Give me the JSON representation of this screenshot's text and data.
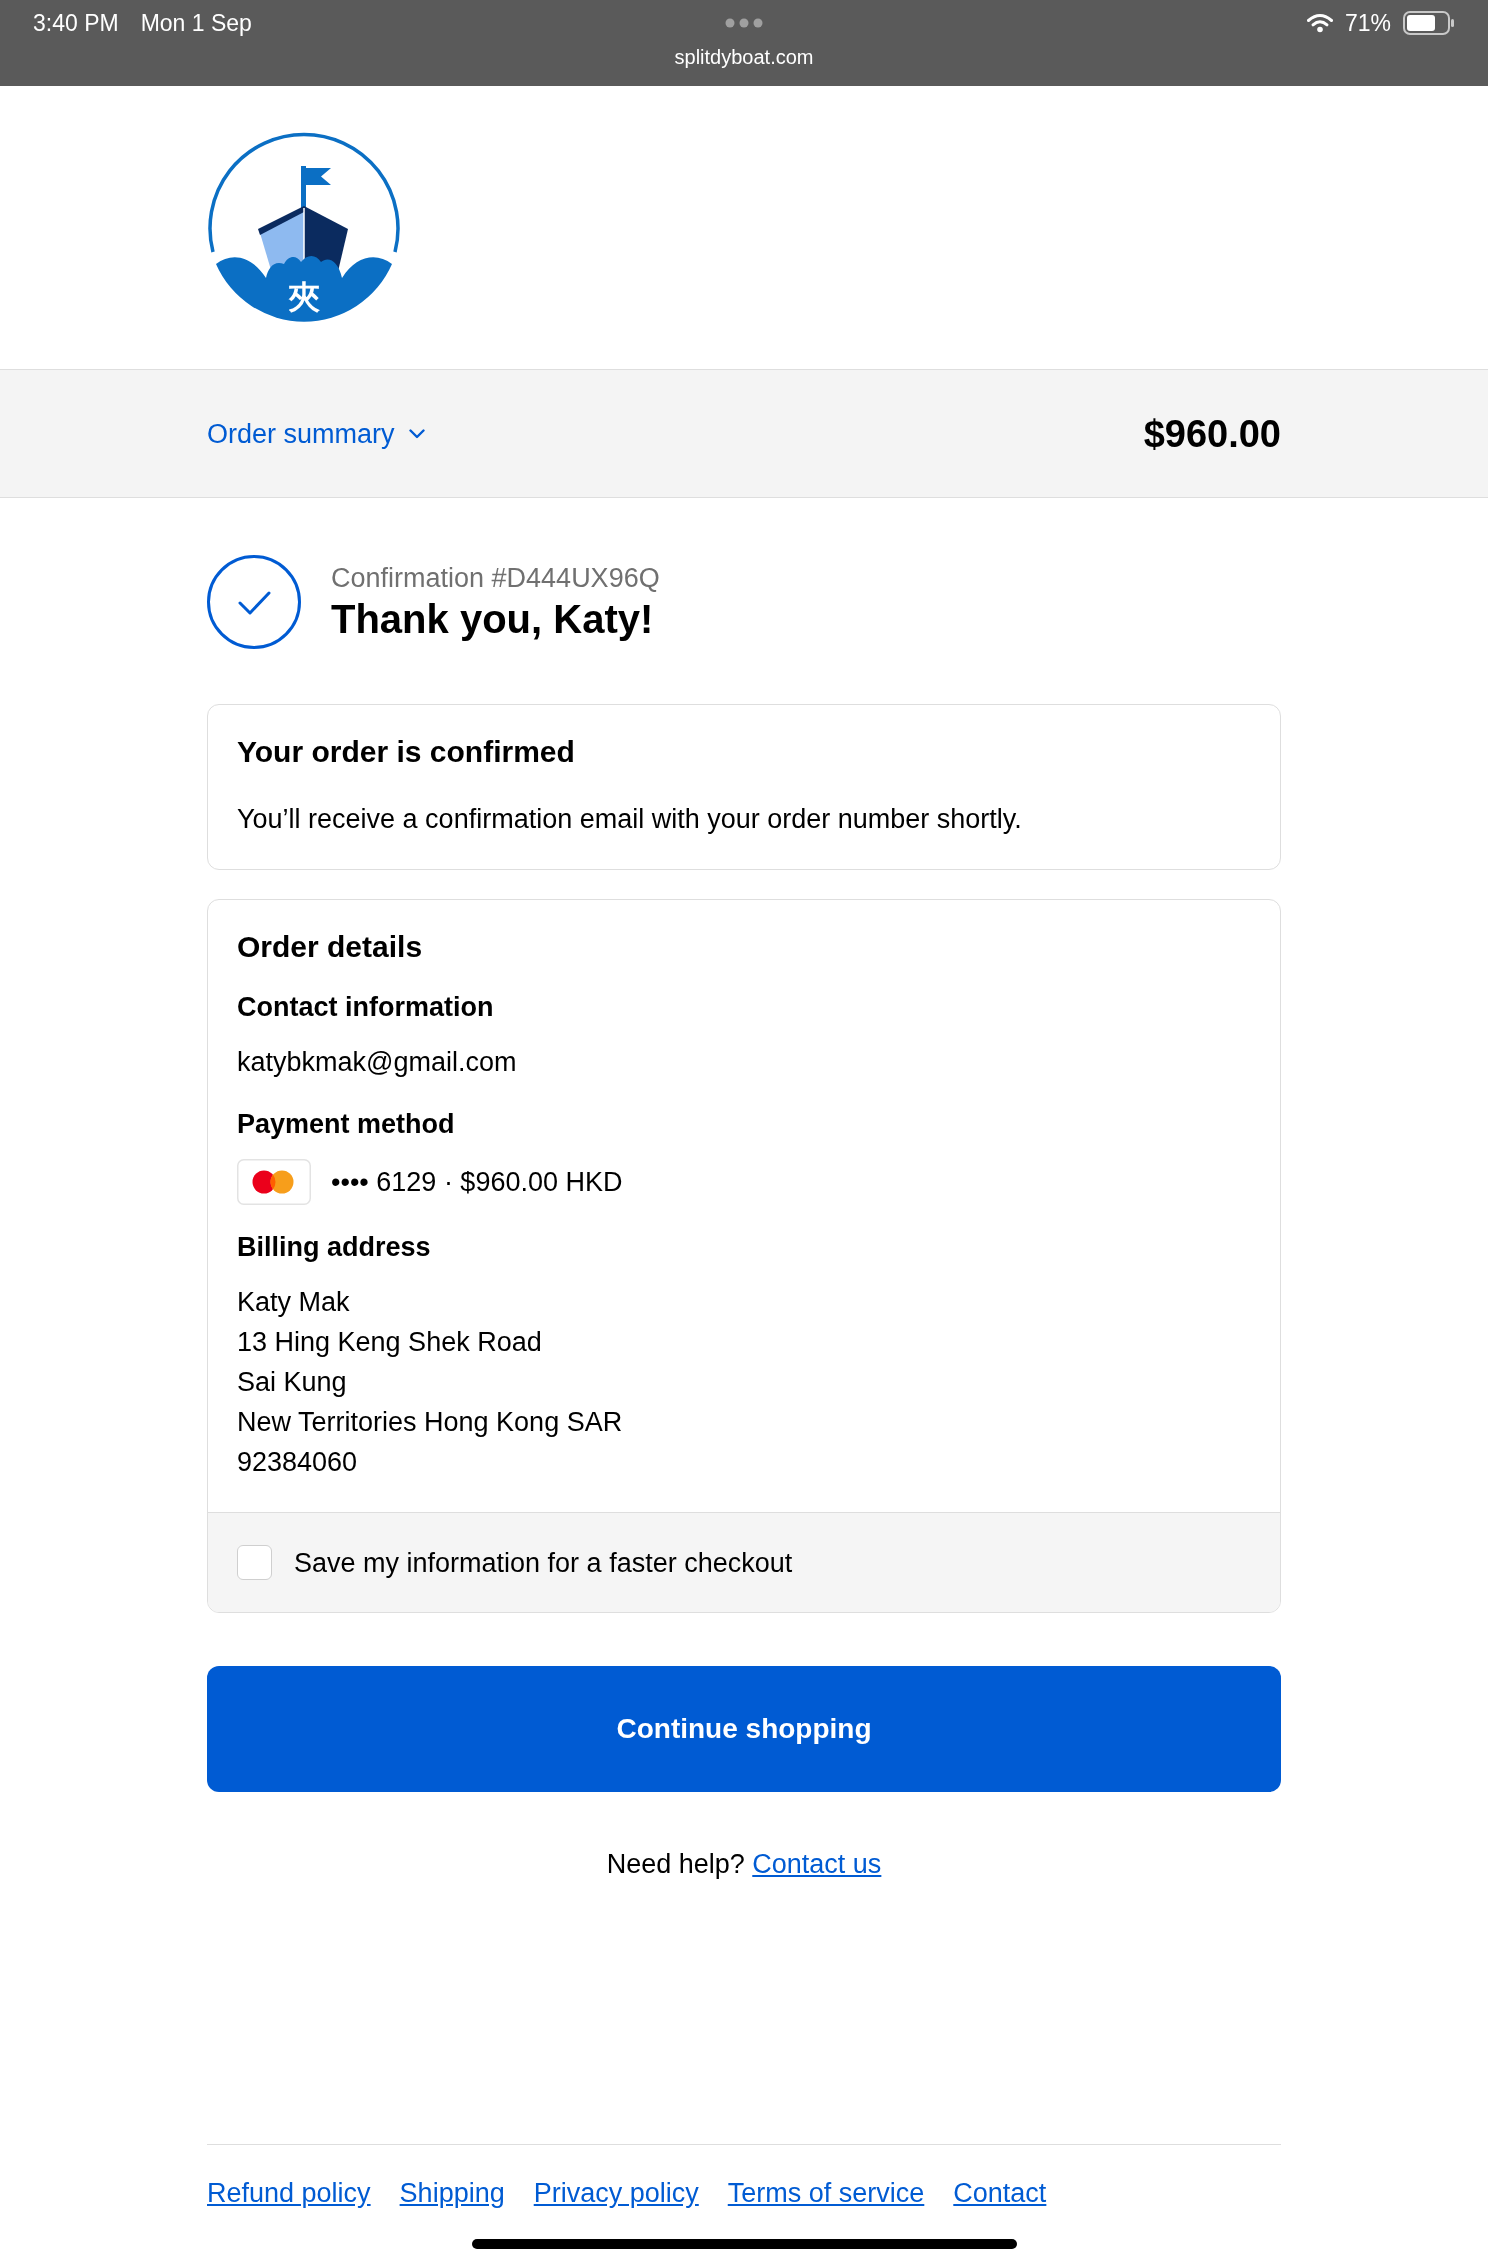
{
  "status_bar": {
    "time": "3:40 PM",
    "date": "Mon 1 Sep",
    "url": "splitdyboat.com",
    "battery": "71%"
  },
  "header": {
    "logo_text": "夾"
  },
  "order_summary": {
    "label": "Order summary",
    "expanded": false,
    "total": "$960.00"
  },
  "confirmation": {
    "number": "Confirmation #D444UX96Q",
    "title": "Thank you, Katy!"
  },
  "confirmed_card": {
    "title": "Your order is confirmed",
    "message": "You’ll receive a confirmation email with your order number shortly."
  },
  "order_details": {
    "title": "Order details",
    "sections": [
      {
        "kind": "text",
        "heading": "Contact information",
        "lines": [
          "katybkmak@gmail.com"
        ]
      },
      {
        "kind": "payment",
        "heading": "Payment method",
        "text": "•••• 6129 · $960.00 HKD"
      },
      {
        "kind": "text",
        "heading": "Billing address",
        "lines": [
          "Katy Mak",
          "13 Hing Keng Shek Road",
          "Sai Kung",
          "New Territories Hong Kong SAR",
          "92384060"
        ]
      }
    ],
    "save_option": {
      "label": "Save my information for a faster checkout",
      "checked": false
    }
  },
  "continue_button": "Continue shopping",
  "help": {
    "text": "Need help?",
    "link": "Contact us"
  },
  "footer_links": [
    "Refund policy",
    "Shipping",
    "Privacy policy",
    "Terms of service",
    "Contact"
  ]
}
